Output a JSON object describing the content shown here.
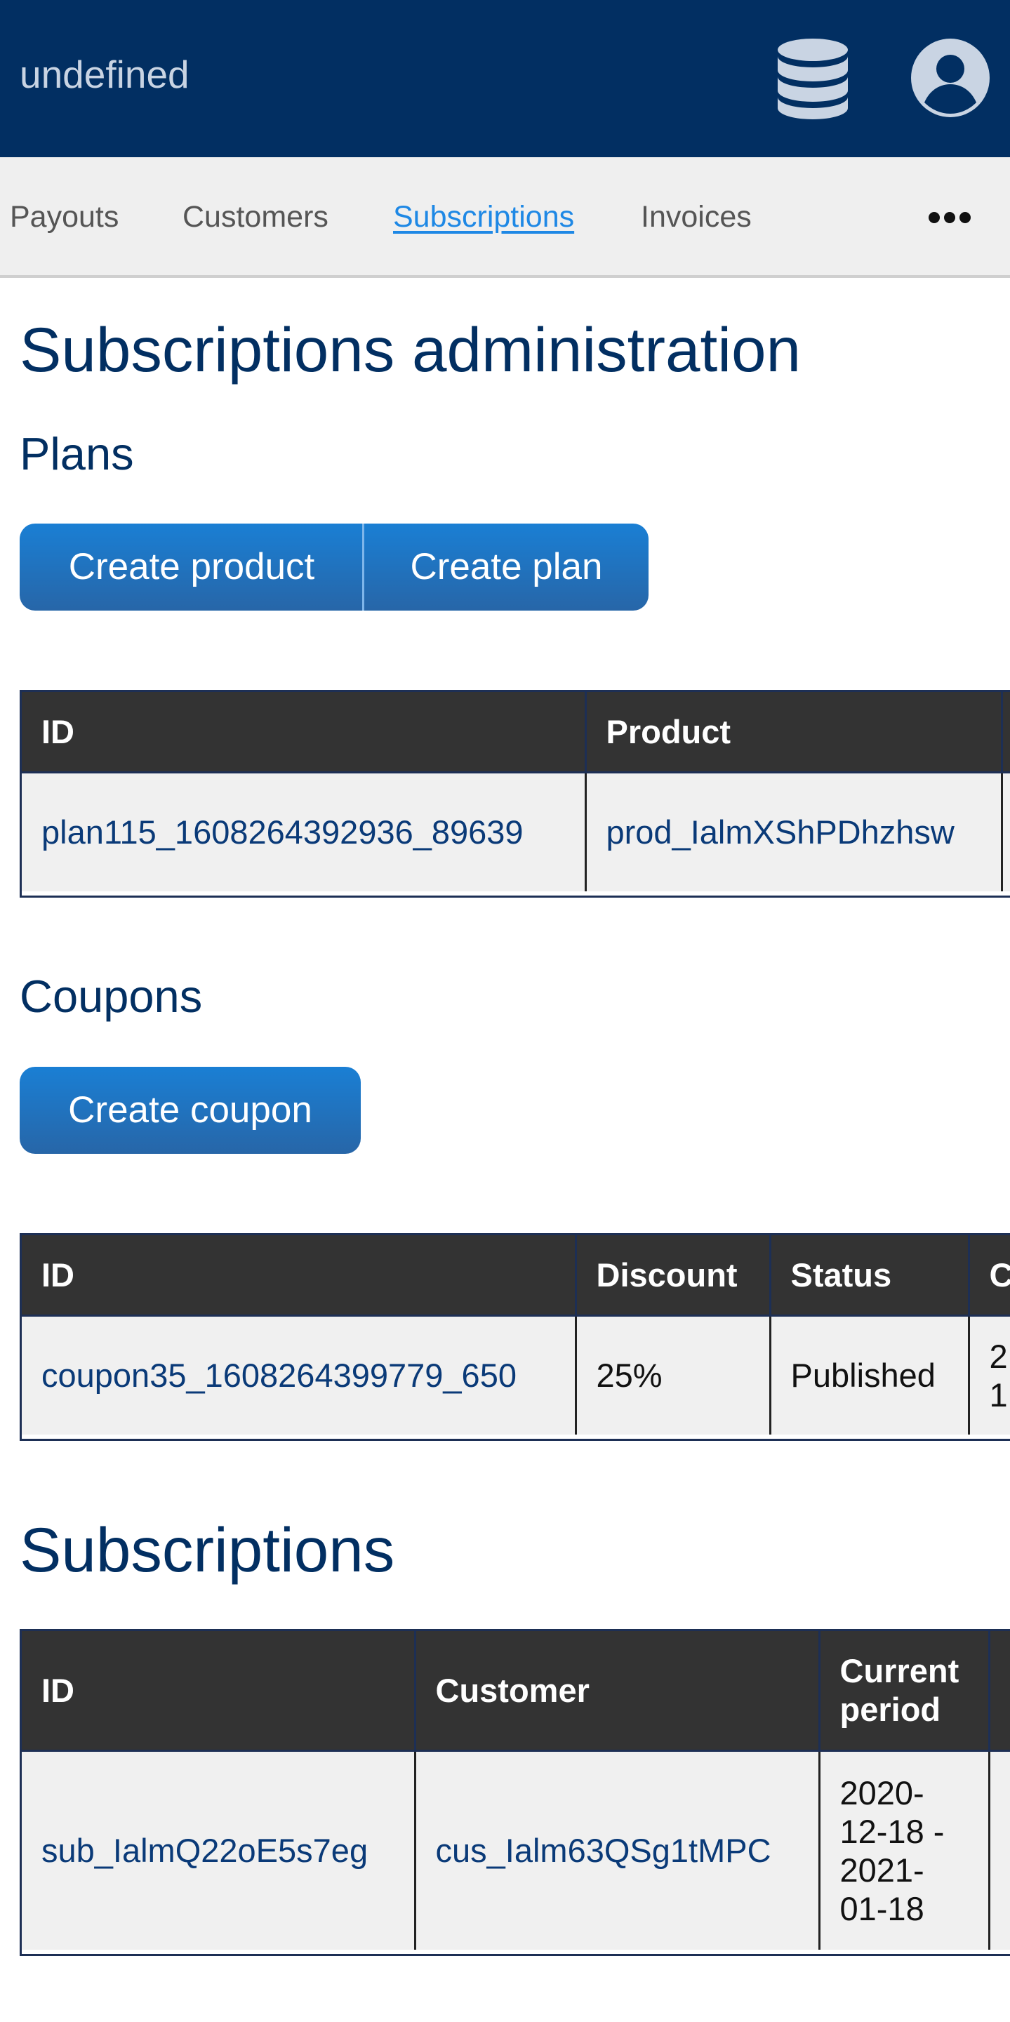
{
  "header": {
    "app_title": "undefined",
    "icons": {
      "database": "database-icon",
      "account": "account-circle-icon"
    }
  },
  "nav": {
    "items": [
      {
        "label": "Payouts",
        "active": false
      },
      {
        "label": "Customers",
        "active": false
      },
      {
        "label": "Subscriptions",
        "active": true
      },
      {
        "label": "Invoices",
        "active": false
      }
    ],
    "more_icon": "more-horizontal-icon"
  },
  "page": {
    "title": "Subscriptions administration"
  },
  "plans": {
    "heading": "Plans",
    "create_product_label": "Create product",
    "create_plan_label": "Create plan",
    "table": {
      "headers": [
        "ID",
        "Product"
      ],
      "rows": [
        [
          "plan115_1608264392936_89639",
          "prod_IalmXShPDhzhsw"
        ]
      ]
    }
  },
  "coupons": {
    "heading": "Coupons",
    "create_coupon_label": "Create coupon",
    "table": {
      "headers": [
        "ID",
        "Discount",
        "Status",
        "C"
      ],
      "rows": [
        [
          "coupon35_1608264399779_650",
          "25%",
          "Published",
          "2\n1"
        ]
      ]
    }
  },
  "subscriptions": {
    "heading": "Subscriptions",
    "table": {
      "headers": [
        "ID",
        "Customer",
        "Current period"
      ],
      "rows": [
        [
          "sub_IalmQ22oE5s7eg",
          "cus_Ialm63QSg1tMPC",
          "2020-12-18 - 2021-01-18"
        ]
      ]
    }
  },
  "colors": {
    "header_bg": "#022f62",
    "heading_text": "#022f62",
    "button_gradient_top": "#1a7fd4",
    "button_gradient_bottom": "#2766a8",
    "table_header_bg": "#333333",
    "nav_active": "#1e88e5"
  }
}
